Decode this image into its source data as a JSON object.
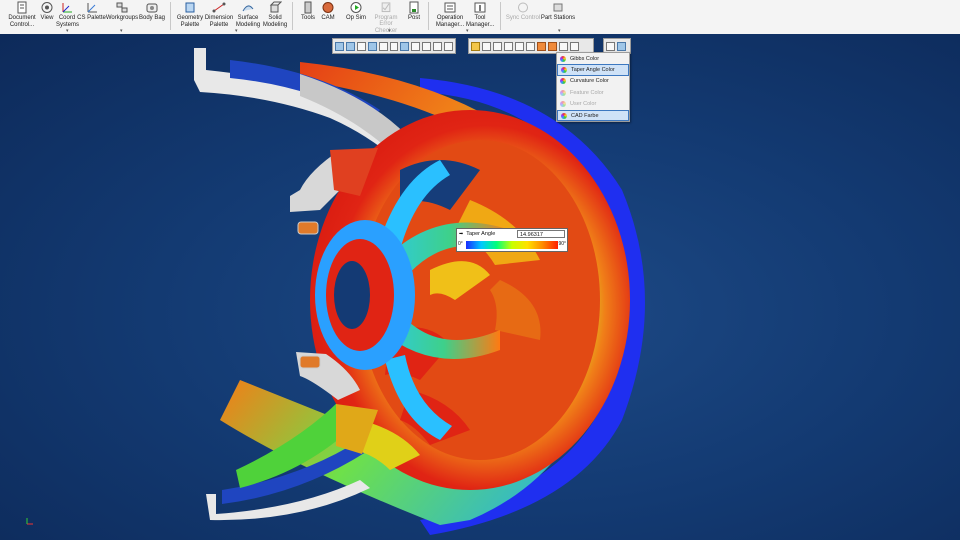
{
  "ribbon": {
    "document_control": "Document Control...",
    "view": "View",
    "coord_systems": "Coord Systems",
    "cs_palette": "CS Palette",
    "workgroups": "Workgroups",
    "body_bag": "Body Bag",
    "geometry_palette": "Geometry Palette",
    "dimension_palette": "Dimension Palette",
    "surface_modeling": "Surface Modeling",
    "solid_modeling": "Solid Modeling",
    "tools": "Tools",
    "cam": "CAM",
    "op_sim": "Op Sim",
    "program_error_checker": "Program Error Checker",
    "post": "Post",
    "operation_manager": "Operation Manager...",
    "tool_manager": "Tool Manager...",
    "sync_control": "Sync Control",
    "part_stations": "Part Stations"
  },
  "color_menu": {
    "items": [
      {
        "label": "Gibbs Color",
        "state": "enabled"
      },
      {
        "label": "Taper Angle Color",
        "state": "highlighted"
      },
      {
        "label": "Curvature Color",
        "state": "enabled"
      },
      {
        "label": "Feature Color",
        "state": "disabled"
      },
      {
        "label": "User Color",
        "state": "disabled"
      },
      {
        "label": "CAD Farbe",
        "state": "selected"
      }
    ]
  },
  "probe": {
    "label": "Taper Angle",
    "value": "14.96317",
    "min_label": "0°",
    "max_label": "90°"
  },
  "colors": {
    "viewport_bg": "#133a72",
    "ribbon_bg": "#f4f4f4",
    "menu_highlight": "#cfe2f7"
  }
}
